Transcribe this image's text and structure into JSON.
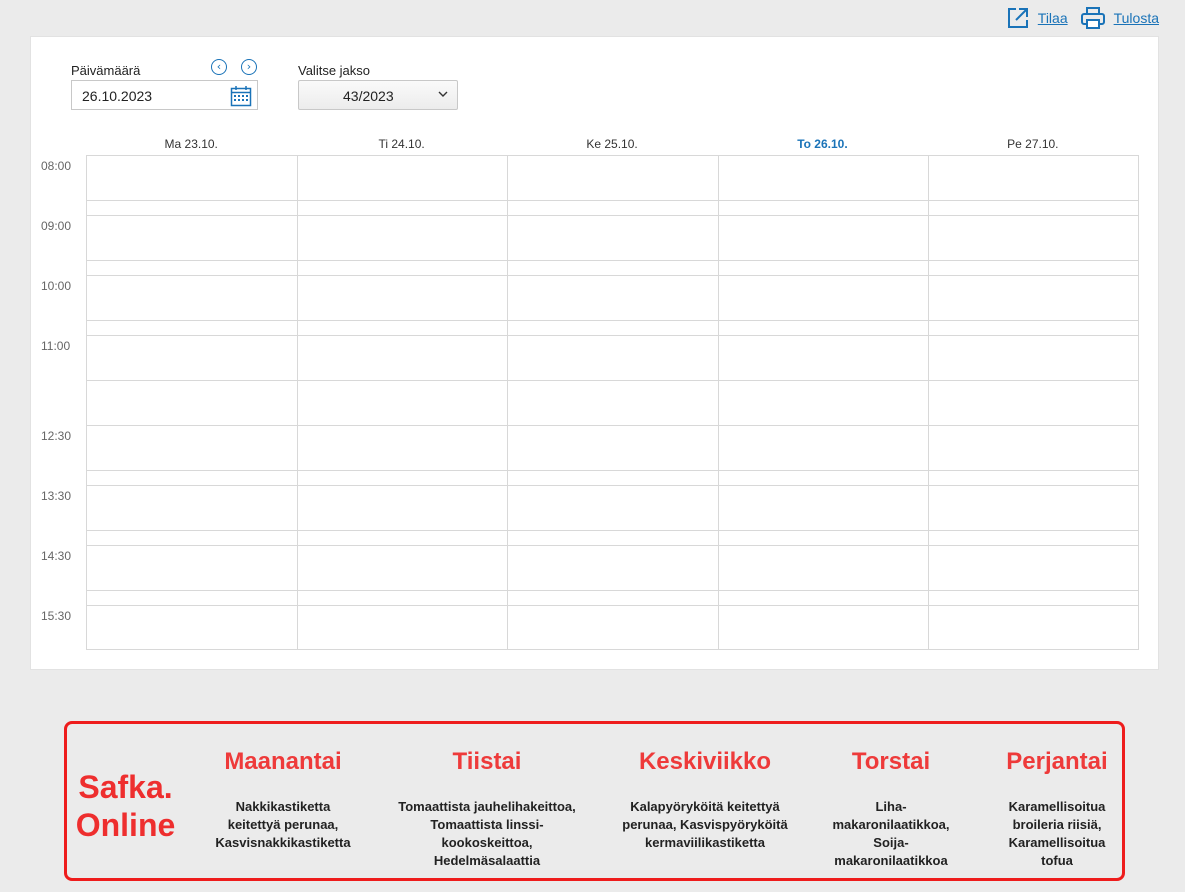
{
  "toplinks": {
    "order_label": "Tilaa",
    "print_label": "Tulosta"
  },
  "date_picker": {
    "label": "Päivämäärä",
    "value": "26.10.2023"
  },
  "period": {
    "label": "Valitse jakso",
    "value": "43/2023"
  },
  "calendar": {
    "days": [
      "Ma 23.10.",
      "Ti 24.10.",
      "Ke 25.10.",
      "To 26.10.",
      "Pe 27.10."
    ],
    "today_index": 3,
    "time_slots": [
      "08:00",
      "09:00",
      "10:00",
      "11:00",
      "12:30",
      "13:30",
      "14:30",
      "15:30"
    ]
  },
  "banner": {
    "brand_line1": "Safka.",
    "brand_line2": "Online",
    "days": [
      {
        "title": "Maanantai",
        "menu": [
          "Nakkikastiketta",
          "keitettyä perunaa,",
          "Kasvisnakkikastiketta"
        ]
      },
      {
        "title": "Tiistai",
        "menu": [
          "Tomaattista jauhelihakeittoa,",
          "Tomaattista linssi-",
          "kookoskeittoa,",
          "Hedelmäsalaattia"
        ]
      },
      {
        "title": "Keskiviikko",
        "menu": [
          "Kalapyöryköitä keitettyä",
          "perunaa, Kasvispyöryköitä",
          "kermaviilikastiketta"
        ]
      },
      {
        "title": "Torstai",
        "menu": [
          "Liha-",
          "makaronilaatikkoa,",
          "Soija-",
          "makaronilaatikkoa"
        ]
      },
      {
        "title": "Perjantai",
        "menu": [
          "Karamellisoitua",
          "broileria riisiä,",
          "Karamellisoitua",
          "tofua"
        ]
      }
    ]
  },
  "colors": {
    "accent": "#1a73b8",
    "banner_red": "#ee1c1c"
  }
}
